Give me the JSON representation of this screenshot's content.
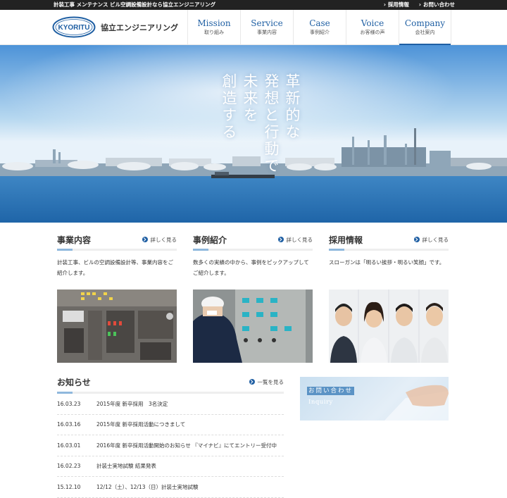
{
  "topbar": {
    "tagline": "計装工事 メンテナンス ビル空調設備設計なら協立エンジニアリング",
    "links": [
      "採用情報",
      "お問い合わせ"
    ]
  },
  "header": {
    "logo_text": "KYORITU",
    "brand": "協立エンジニアリング",
    "nav": [
      {
        "en": "Mission",
        "jp": "取り組み"
      },
      {
        "en": "Service",
        "jp": "事業内容"
      },
      {
        "en": "Case",
        "jp": "事例紹介"
      },
      {
        "en": "Voice",
        "jp": "お客様の声"
      },
      {
        "en": "Company",
        "jp": "会社案内"
      }
    ]
  },
  "hero": {
    "lines": [
      "革新的な",
      "発想と行動で",
      "未来を",
      "創造する"
    ]
  },
  "columns": [
    {
      "title": "事業内容",
      "more": "詳しく見る",
      "text": "計装工事、ビルの空調設備設計等、事業内容をご紹介します。"
    },
    {
      "title": "事例紹介",
      "more": "詳しく見る",
      "text": "数多くの実績の中から、事例をピックアップしてご紹介します。"
    },
    {
      "title": "採用情報",
      "more": "詳しく見る",
      "text": "スローガンは「明るい挨拶・明るい笑顔」です。"
    }
  ],
  "news": {
    "title": "お知らせ",
    "more": "一覧を見る",
    "items": [
      {
        "date": "16.03.23",
        "title": "2015年度 新卒採用　3名決定"
      },
      {
        "date": "16.03.16",
        "title": "2015年度 新卒採用活動につきまして"
      },
      {
        "date": "16.03.01",
        "title": "2016年度 新卒採用活動開始のお知らせ 『マイナビ』にてエントリー受付中"
      },
      {
        "date": "16.02.23",
        "title": "計装士実地試験 結果発表"
      },
      {
        "date": "15.12.10",
        "title": "12/12（土）、12/13（日）計装士実地試験"
      }
    ]
  },
  "inquiry": {
    "jp": "お問い合わせ",
    "en": "Inquiry"
  },
  "colors": {
    "accent": "#1f5fa3",
    "topbar": "#222222"
  }
}
